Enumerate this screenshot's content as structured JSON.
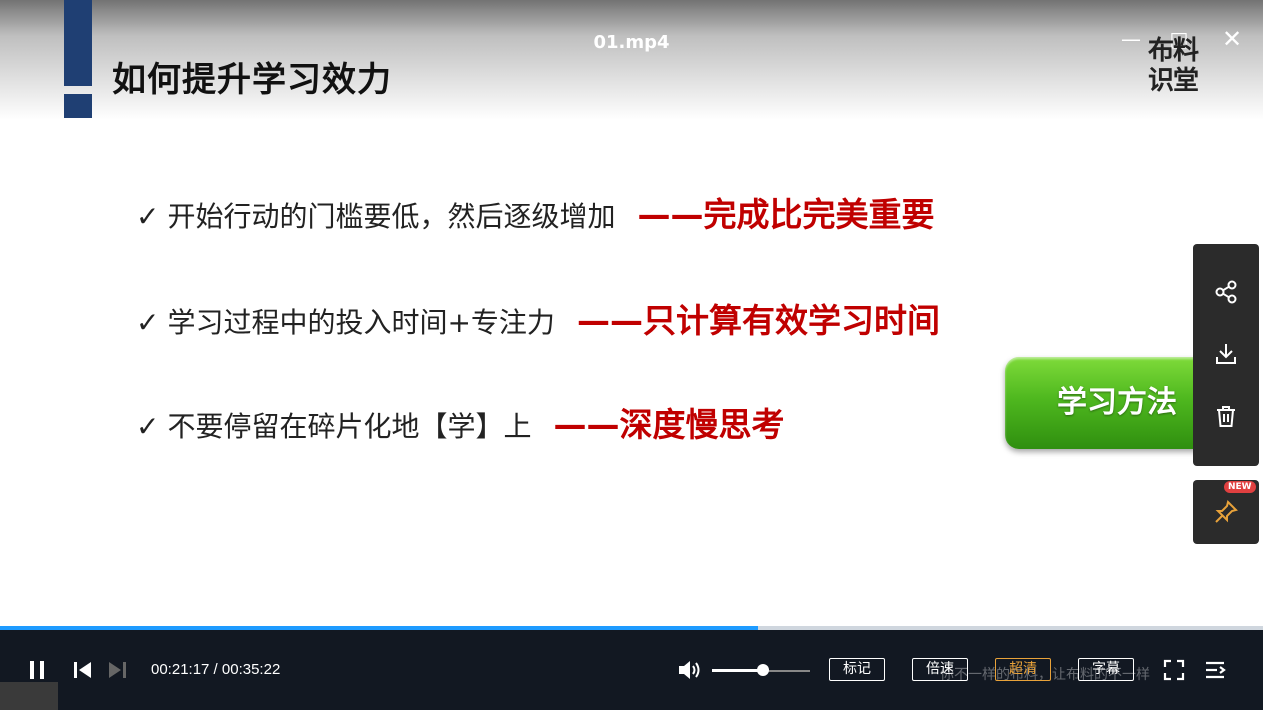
{
  "window": {
    "title": "01.mp4",
    "minimize": "—",
    "maximize": "□",
    "close": "✕"
  },
  "logo": {
    "line1": "布料",
    "line2": "识堂"
  },
  "slide": {
    "title": "如何提升学习效力",
    "check": "✓",
    "bullets": [
      {
        "text": "开始行动的门槛要低，然后逐级增加",
        "emphasis": "——完成比完美重要"
      },
      {
        "text": "学习过程中的投入时间+专注力",
        "emphasis": "——只计算有效学习时间"
      },
      {
        "text": "不要停留在碎片化地【学】上",
        "emphasis": "——深度慢思考"
      }
    ],
    "tag_button": "学习方法"
  },
  "side_panel": {
    "icons": [
      "share-icon",
      "download-icon",
      "delete-icon"
    ],
    "pin_badge": "NEW"
  },
  "player": {
    "progress_fraction": 0.6,
    "volume_fraction": 0.52,
    "time_display": "00:21:17 / 00:35:22",
    "buttons": {
      "mark": "标记",
      "speed": "倍速",
      "quality": "超清",
      "subtitles": "字幕"
    },
    "subtitle_overlay": "你不一样的布料，让布料的不一样",
    "accent_color": "#1e9bff",
    "active_color": "#e8a23a"
  }
}
